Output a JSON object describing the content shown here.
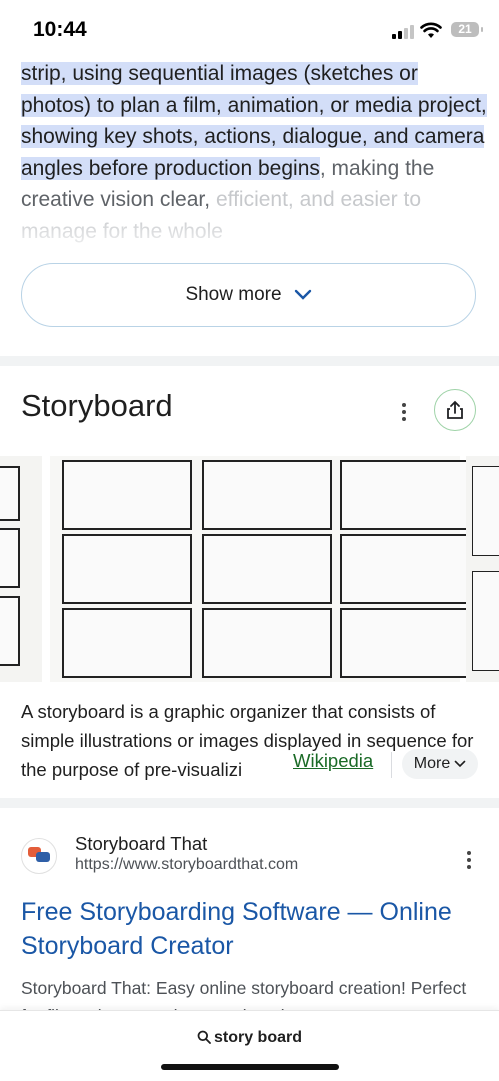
{
  "status": {
    "time": "10:44",
    "battery": "21"
  },
  "snippet": {
    "highlighted": "strip, using sequential images (sketches or photos) to plan a film, animation, or media project, showing key shots, actions, dialogue, and camera angles before production begins",
    "continuation": ", making the creative vision clear,",
    "faded": "efficient, and easier to manage for the whole",
    "show_more": "Show more"
  },
  "knowledge_panel": {
    "title": "Storyboard",
    "description": "A storyboard is a graphic organizer that consists of simple illustrations or images displayed in sequence for the purpose of pre-visualizi",
    "source_link": "Wikipedia",
    "more_label": "More"
  },
  "result": {
    "site_name": "Storyboard That",
    "url": "https://www.storyboardthat.com",
    "title": "Free Storyboarding Software — Online Storyboard Creator",
    "snippet": "Storyboard That: Easy online storyboard creation! Perfect for filmmakers, teachers, and students. Create"
  },
  "bottom_bar": {
    "query": "story board"
  },
  "colors": {
    "link_blue": "#1a57a6",
    "wiki_green": "#1a6a26",
    "highlight": "#d3def8"
  },
  "icons": [
    "signal-icon",
    "wifi-icon",
    "battery-icon",
    "chevron-down-icon",
    "more-vert-icon",
    "share-icon",
    "search-icon"
  ]
}
